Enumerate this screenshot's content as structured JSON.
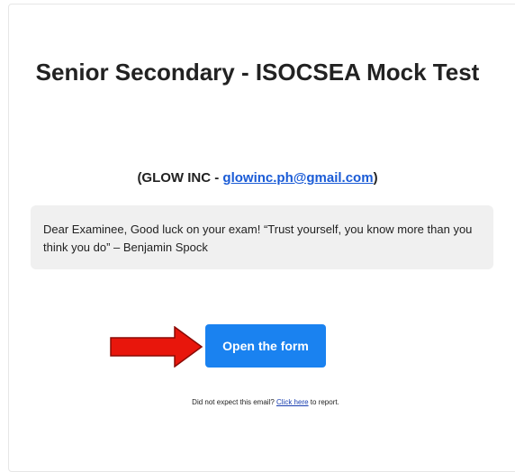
{
  "email": {
    "title": "Senior Secondary - ISOCSEA Mock Test",
    "subtitle_prefix": "(GLOW INC - ",
    "subtitle_email": "glowinc.ph@gmail.com",
    "subtitle_suffix": ")",
    "message": "Dear Examinee, Good luck on your exam! “Trust yourself, you know more than you think you do” – Benjamin Spock",
    "button_label": "Open the form",
    "footer_prefix": "Did not expect this email? ",
    "footer_link": "Click here",
    "footer_suffix": " to report."
  },
  "colors": {
    "button_bg": "#1a82f0",
    "arrow": "#e8160c",
    "quote_bg": "#f0f0f0",
    "link": "#1a5bd6"
  },
  "icons": {
    "arrow": "arrow-right-icon"
  }
}
